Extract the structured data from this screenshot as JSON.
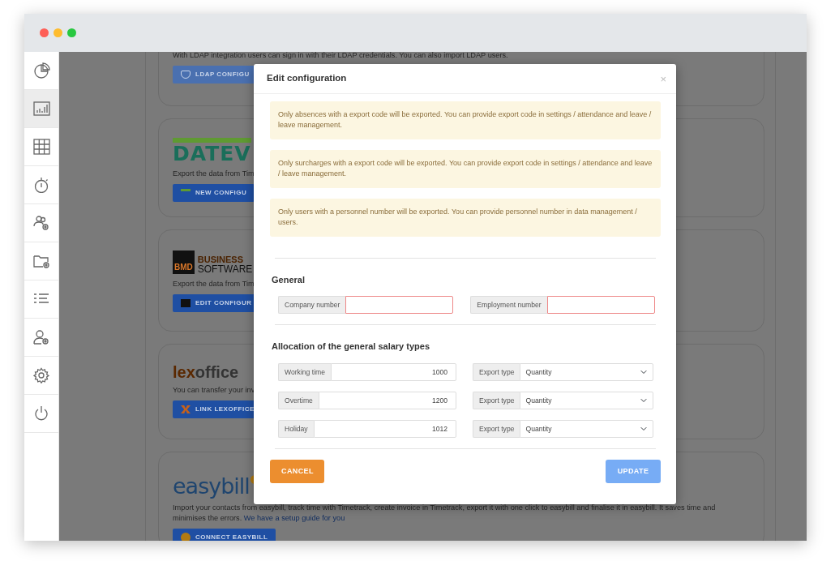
{
  "window": {
    "controls": [
      {
        "color": "#fe5f57"
      },
      {
        "color": "#febc2e"
      },
      {
        "color": "#28c840"
      }
    ]
  },
  "sidebar": {
    "items": [
      {
        "selected": false
      },
      {
        "selected": true
      },
      {
        "selected": false
      },
      {
        "selected": false
      },
      {
        "selected": false
      },
      {
        "selected": false
      },
      {
        "selected": false
      },
      {
        "selected": false
      },
      {
        "selected": false
      },
      {
        "selected": false
      }
    ]
  },
  "background_cards": [
    {
      "kind": "ldap",
      "description": "With LDAP integration users can sign in with their LDAP credentials. You can also import LDAP users.",
      "button": "LDAP CONFIGU"
    },
    {
      "kind": "datev",
      "logo": [
        "DATEV"
      ],
      "description": "Export the data from Tim",
      "button": "NEW CONFIGU"
    },
    {
      "kind": "bmd",
      "logo": [
        "BMD",
        "BUSINESS",
        "SOFTWARE"
      ],
      "description": "Export the data from Tim",
      "button": "EDIT CONFIGUR"
    },
    {
      "kind": "lexoffice",
      "logo": [
        "lex",
        "office"
      ],
      "description": "You can transfer your inv",
      "button": "LINK LEXOFFICE"
    },
    {
      "kind": "easybill",
      "logo": [
        "easybill"
      ],
      "description": "Import your contacts from easybill, track time with Timetrack, create invoice in Timetrack, export it with one click to easybill and finalise it in easybill. It saves time and minimises the errors.",
      "link": "We have a setup guide for you",
      "button": "CONNECT EASYBILL"
    }
  ],
  "modal": {
    "title": "Edit configuration",
    "close": "×",
    "alerts": [
      "Only absences with a export code will be exported. You can provide export code in settings / attendance and leave / leave management.",
      "Only surcharges with a export code will be exported. You can provide export code in settings / attendance and leave / leave management.",
      "Only users with a personnel number will be exported. You can provide personnel number in data management / users."
    ],
    "general": {
      "title": "General",
      "fields": [
        {
          "label": "Company number",
          "invalid": true
        },
        {
          "label": "Employment number",
          "invalid": true
        }
      ]
    },
    "allocation": {
      "title": "Allocation of the general salary types",
      "rows": [
        {
          "label": "Working time",
          "value": "1000",
          "export_label": "Export type",
          "export_value": "Quantity"
        },
        {
          "label": "Overtime",
          "value": "1200",
          "export_label": "Export type",
          "export_value": "Quantity"
        },
        {
          "label": "Holiday",
          "value": "1012",
          "export_label": "Export type",
          "export_value": "Quantity"
        }
      ]
    },
    "buttons": [
      {
        "kind": "cancel",
        "label": "CANCEL",
        "disabled": false
      },
      {
        "kind": "update",
        "label": "UPDATE",
        "disabled": true
      }
    ]
  }
}
